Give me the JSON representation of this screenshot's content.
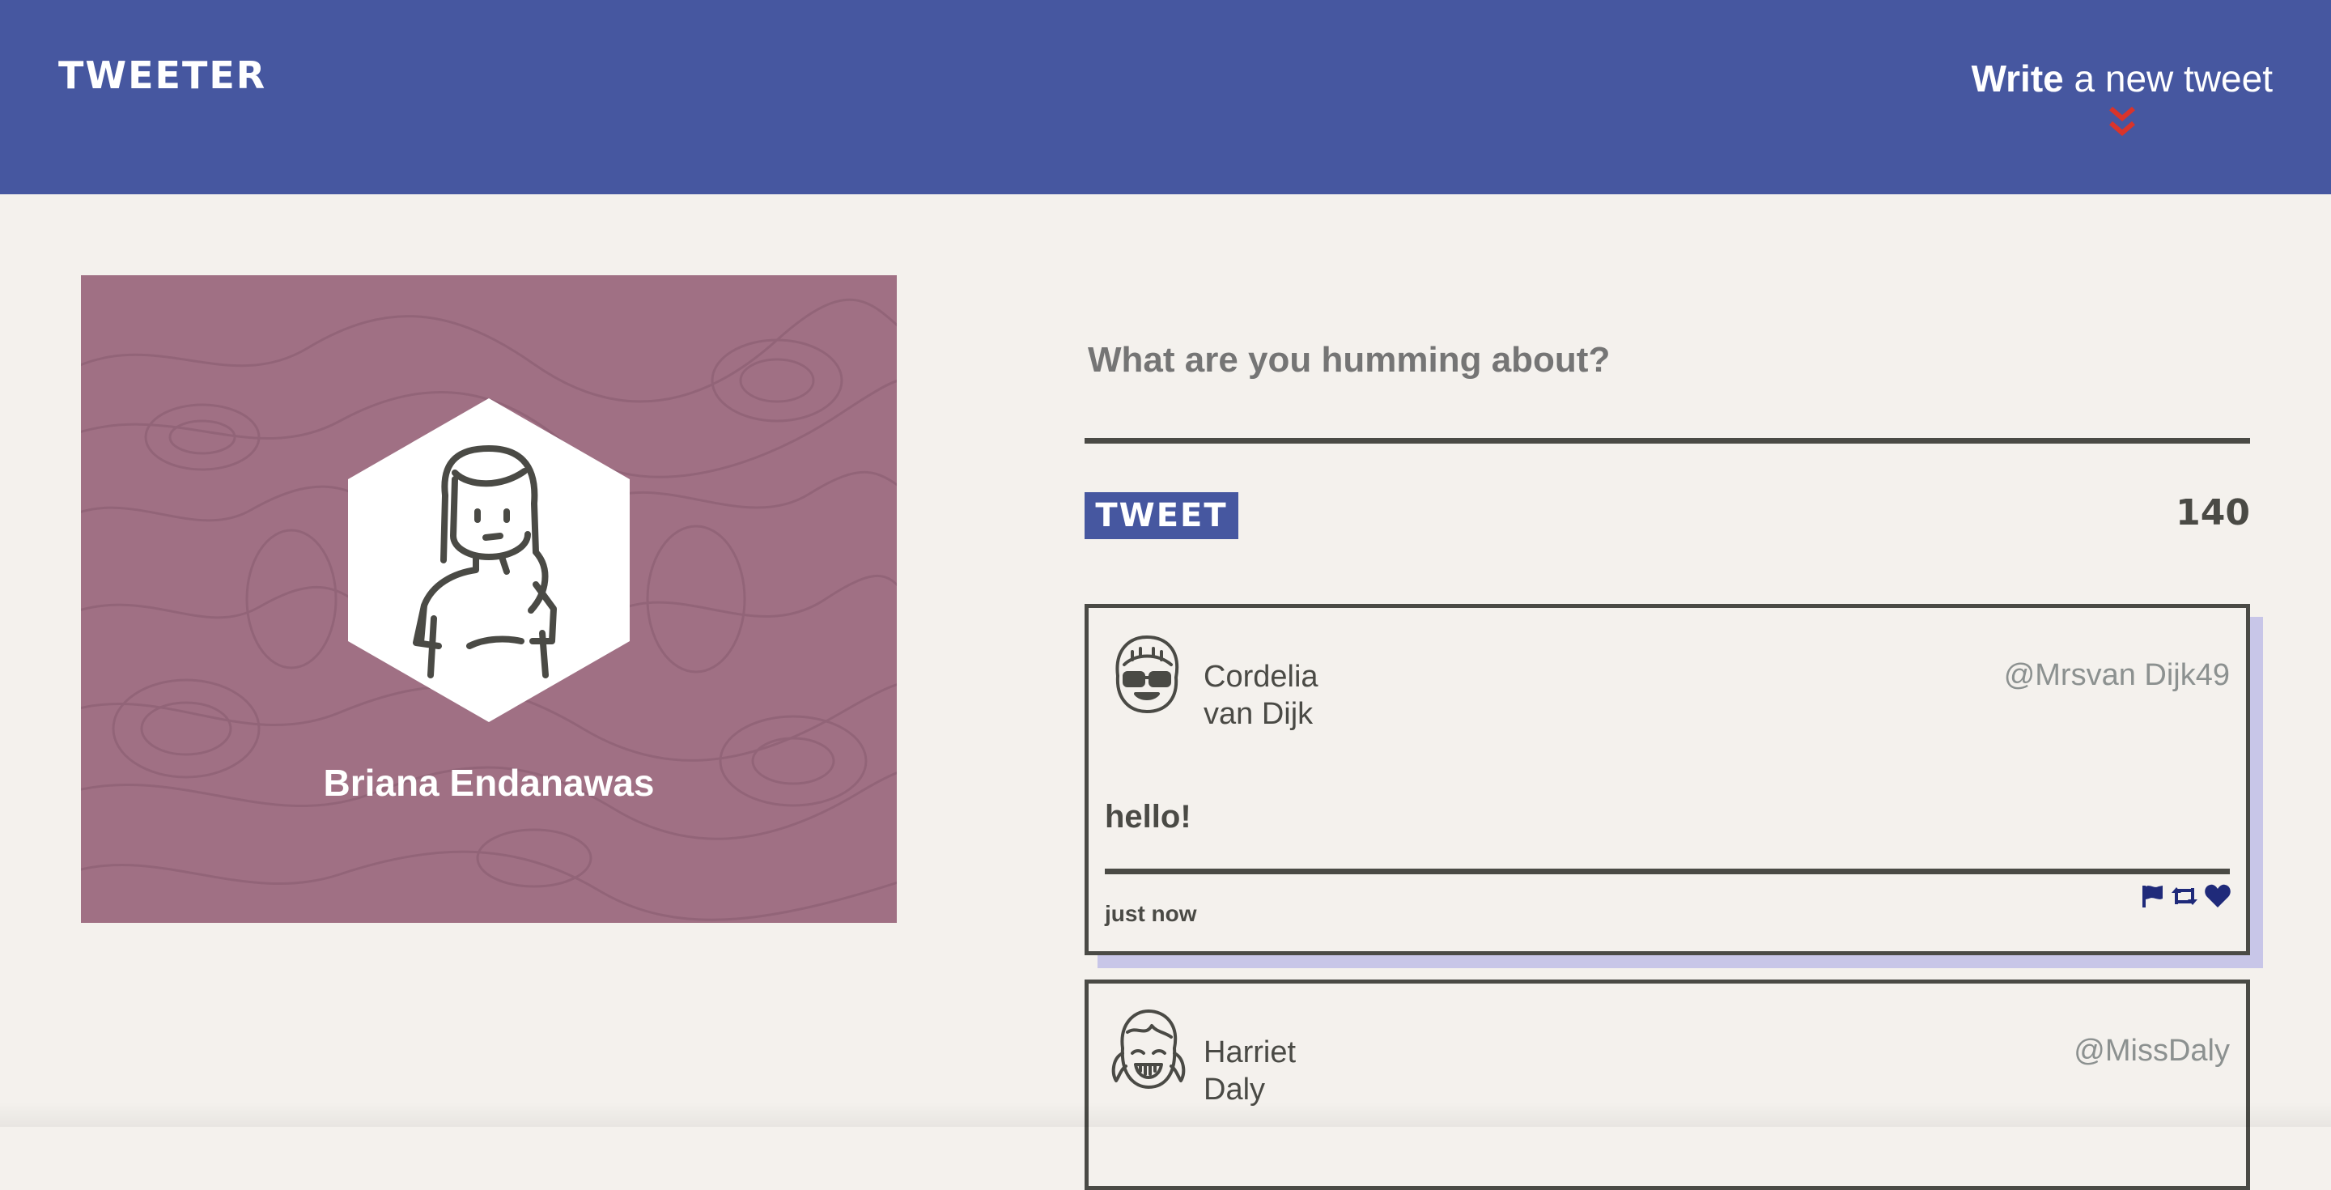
{
  "header": {
    "logo": "TWEETER",
    "compose_bold": "Write",
    "compose_rest": " a new tweet",
    "compose_icon": "double-chevron-down-icon"
  },
  "profile": {
    "name": "Briana Endanawas",
    "avatar_icon": "woman-avatar-icon",
    "background_color": "#a07084"
  },
  "new_tweet": {
    "placeholder": "What are you humming about?",
    "button_label": "TWEET",
    "counter": "140"
  },
  "tweets": [
    {
      "first_name": "Cordelia",
      "last_name": "van Dijk",
      "handle": "@Mrsvan Dijk49",
      "content": "hello!",
      "time": "just now",
      "avatar_icon": "girl-sunglasses-avatar-icon"
    },
    {
      "first_name": "Harriet",
      "last_name": "Daly",
      "handle": "@MissDaly",
      "avatar_icon": "girl-pigtails-avatar-icon"
    }
  ],
  "colors": {
    "header": "#4657a0",
    "page_background": "#f4f1ed",
    "text": "#4a4a45",
    "accent_red": "#d9342b",
    "action_icons": "#1f2a7a",
    "tweet_shadow": "#c8c6e8"
  }
}
